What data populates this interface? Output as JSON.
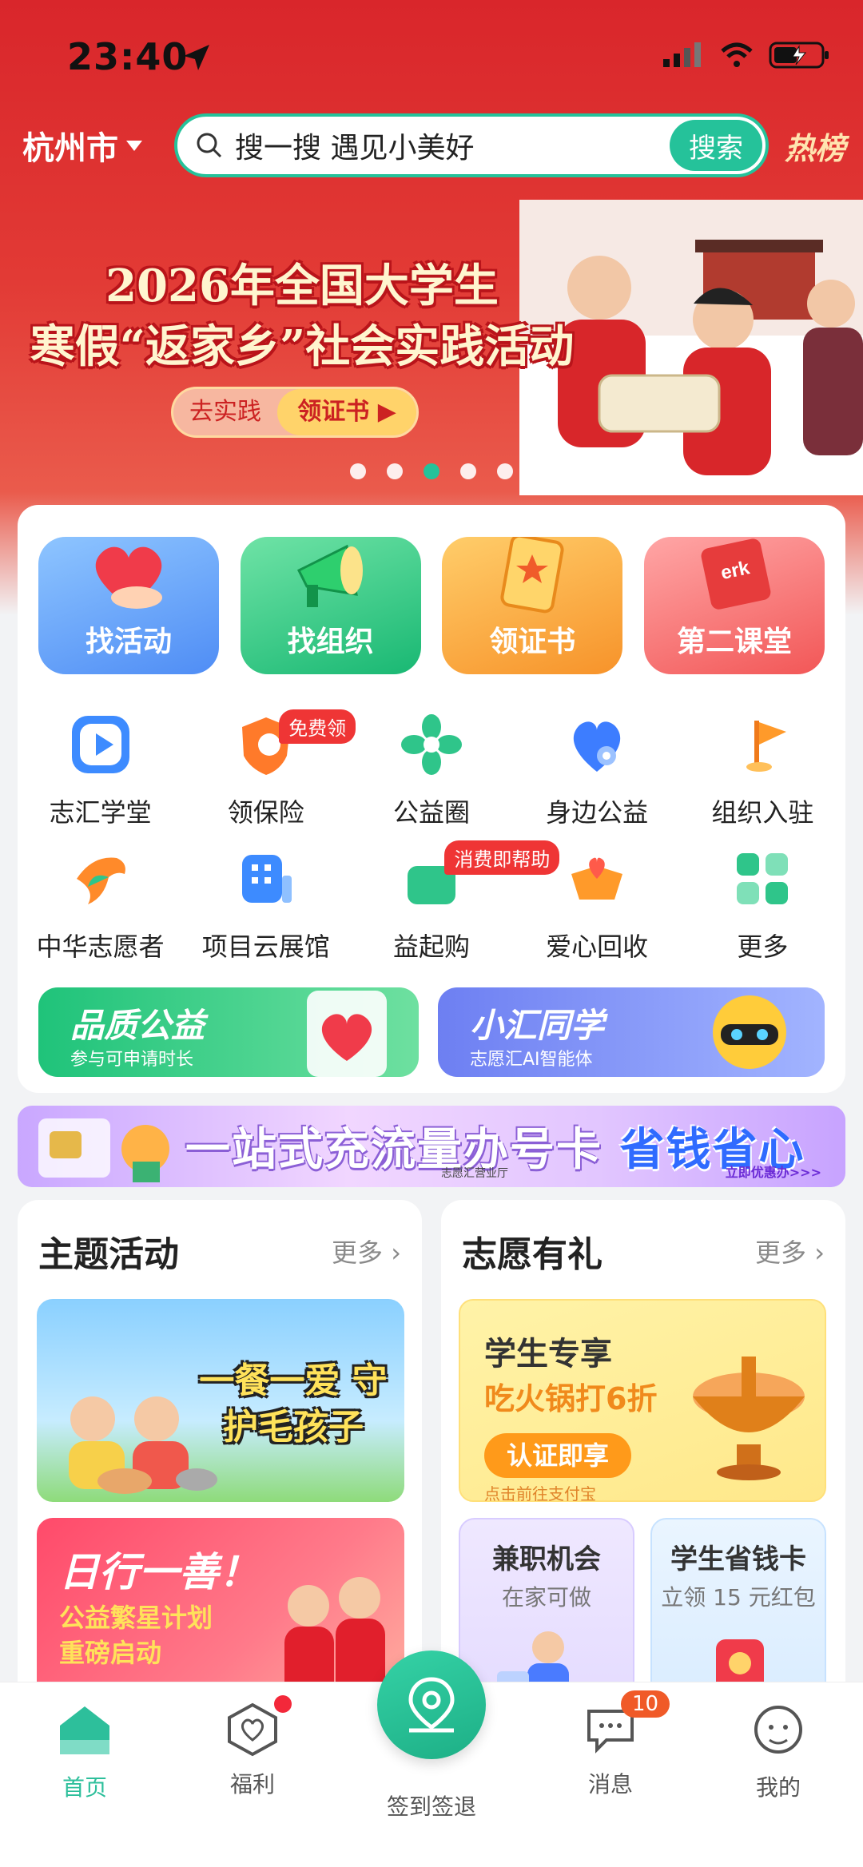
{
  "status": {
    "time": "23:40"
  },
  "topbar": {
    "city": "杭州市",
    "search_placeholder": "搜一搜 遇见小美好",
    "search_button": "搜索",
    "hot": "热榜"
  },
  "banner": {
    "title_line1": "2026年全国大学生",
    "title_line2": "寒假“返家乡”社会实践活动",
    "cta_left": "去实践",
    "cta_right": "领证书",
    "dot_count": 5,
    "active_dot": 3
  },
  "tiles": [
    {
      "label": "找活动"
    },
    {
      "label": "找组织"
    },
    {
      "label": "领证书"
    },
    {
      "label": "第二课堂"
    }
  ],
  "grid_row1": [
    {
      "label": "志汇学堂",
      "icon": "play-icon"
    },
    {
      "label": "领保险",
      "icon": "insurance-icon",
      "badge": "免费领"
    },
    {
      "label": "公益圈",
      "icon": "pinwheel-icon"
    },
    {
      "label": "身边公益",
      "icon": "heart-location-icon"
    },
    {
      "label": "组织入驻",
      "icon": "flag-icon"
    }
  ],
  "grid_row2": [
    {
      "label": "中华志愿者",
      "icon": "dove-icon"
    },
    {
      "label": "项目云展馆",
      "icon": "building-icon"
    },
    {
      "label": "益起购",
      "icon": "shopping-bag-icon",
      "badge": "消费即帮助"
    },
    {
      "label": "爱心回收",
      "icon": "recycle-box-icon"
    },
    {
      "label": "更多",
      "icon": "grid-icon"
    }
  ],
  "promos": [
    {
      "title": "品质公益",
      "sub": "参与可申请时长"
    },
    {
      "title": "小汇同学",
      "sub": "志愿汇AI智能体"
    }
  ],
  "ad": {
    "text_a": "一站式充流量办号卡 ",
    "text_b": "省钱省心",
    "org": "志愿汇营业厅",
    "more": "立即优惠办>>>"
  },
  "left_col": {
    "title": "主题活动",
    "more": "更多",
    "card1_text": "一餐一爱 守护毛孩子",
    "card2_line1": "日行一善！",
    "card2_line2": "公益繁星计划",
    "card2_line3": "重磅启动"
  },
  "right_col": {
    "title": "志愿有礼",
    "more": "更多",
    "yellow_a": "学生专享",
    "yellow_b": "吃火锅打6折",
    "yellow_btn": "认证即享",
    "yellow_note": "点击前往支付宝",
    "mini1_a": "兼职机会",
    "mini1_b": "在家可做",
    "mini2_a": "学生省钱卡",
    "mini2_b": "立领 15 元红包"
  },
  "tabbar": {
    "home": "首页",
    "welfare": "福利",
    "checkin": "签到签退",
    "messages": "消息",
    "messages_count": "10",
    "mine": "我的"
  },
  "colors": {
    "accent": "#25c29a",
    "brand_red": "#d9262b"
  }
}
